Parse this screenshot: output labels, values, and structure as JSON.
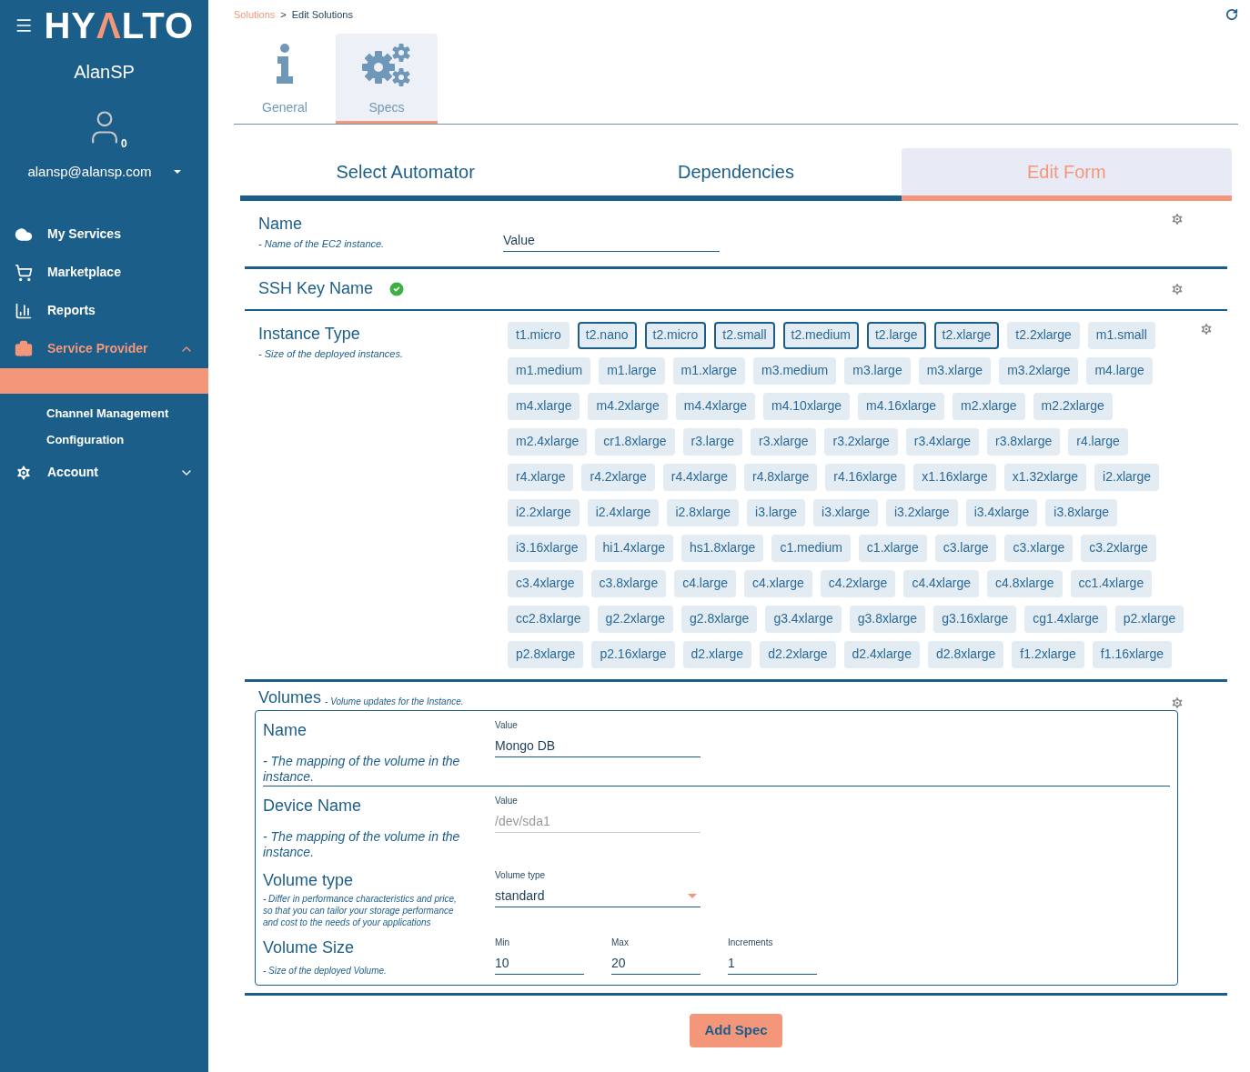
{
  "sidebar": {
    "logo": [
      {
        "text": "HY",
        "accent": false
      },
      {
        "text": "Λ",
        "accent": true
      },
      {
        "text": "LTO",
        "accent": false
      }
    ],
    "user": "AlanSP",
    "notifications": "0",
    "email": "alansp@alansp.com",
    "nav": [
      {
        "kind": "cloud",
        "label": "My Services",
        "selected": false
      },
      {
        "kind": "cart",
        "label": "Marketplace",
        "selected": false
      },
      {
        "kind": "chart",
        "label": "Reports",
        "selected": false
      },
      {
        "kind": "briefcase",
        "label": "Service Provider",
        "selected": true,
        "expanded": true,
        "children": [
          {
            "label": "Channel Management"
          },
          {
            "label": "Configuration"
          }
        ]
      },
      {
        "kind": "gear",
        "label": "Account",
        "selected": false,
        "expanded": false
      }
    ]
  },
  "breadcrumb": [
    {
      "label": "Solutions",
      "link": true
    },
    {
      "label": ">",
      "link": false
    },
    {
      "label": "Edit Solutions",
      "link": false
    }
  ],
  "tabs": [
    {
      "kind": "info",
      "label": "General",
      "selected": false
    },
    {
      "kind": "gears",
      "label": "Specs",
      "selected": true
    }
  ],
  "subtabs": [
    {
      "label": "Select Automator",
      "selected": false
    },
    {
      "label": "Dependencies",
      "selected": false
    },
    {
      "label": "Edit Form",
      "selected": true
    }
  ],
  "name_field": {
    "title": "Name",
    "description": "- Name of the EC2 instance.",
    "value": "Value"
  },
  "ssh_key": {
    "title": "SSH Key Name",
    "valid": true
  },
  "instance_type": {
    "title": "Instance Type",
    "description": "- Size of the deployed instances.",
    "types": [
      {
        "label": "t1.micro",
        "selected": false
      },
      {
        "label": "t2.nano",
        "selected": true
      },
      {
        "label": "t2.micro",
        "selected": true
      },
      {
        "label": "t2.small",
        "selected": true
      },
      {
        "label": "t2.medium",
        "selected": true
      },
      {
        "label": "t2.large",
        "selected": true
      },
      {
        "label": "t2.xlarge",
        "selected": true
      },
      {
        "label": "t2.2xlarge",
        "selected": false
      },
      {
        "label": "m1.small",
        "selected": false
      },
      {
        "label": "m1.medium",
        "selected": false
      },
      {
        "label": "m1.large",
        "selected": false
      },
      {
        "label": "m1.xlarge",
        "selected": false
      },
      {
        "label": "m3.medium",
        "selected": false
      },
      {
        "label": "m3.large",
        "selected": false
      },
      {
        "label": "m3.xlarge",
        "selected": false
      },
      {
        "label": "m3.2xlarge",
        "selected": false
      },
      {
        "label": "m4.large",
        "selected": false
      },
      {
        "label": "m4.xlarge",
        "selected": false
      },
      {
        "label": "m4.2xlarge",
        "selected": false
      },
      {
        "label": "m4.4xlarge",
        "selected": false
      },
      {
        "label": "m4.10xlarge",
        "selected": false
      },
      {
        "label": "m4.16xlarge",
        "selected": false
      },
      {
        "label": "m2.xlarge",
        "selected": false
      },
      {
        "label": "m2.2xlarge",
        "selected": false
      },
      {
        "label": "m2.4xlarge",
        "selected": false
      },
      {
        "label": "cr1.8xlarge",
        "selected": false
      },
      {
        "label": "r3.large",
        "selected": false
      },
      {
        "label": "r3.xlarge",
        "selected": false
      },
      {
        "label": "r3.2xlarge",
        "selected": false
      },
      {
        "label": "r3.4xlarge",
        "selected": false
      },
      {
        "label": "r3.8xlarge",
        "selected": false
      },
      {
        "label": "r4.large",
        "selected": false
      },
      {
        "label": "r4.xlarge",
        "selected": false
      },
      {
        "label": "r4.2xlarge",
        "selected": false
      },
      {
        "label": "r4.4xlarge",
        "selected": false
      },
      {
        "label": "r4.8xlarge",
        "selected": false
      },
      {
        "label": "r4.16xlarge",
        "selected": false
      },
      {
        "label": "x1.16xlarge",
        "selected": false
      },
      {
        "label": "x1.32xlarge",
        "selected": false
      },
      {
        "label": "i2.xlarge",
        "selected": false
      },
      {
        "label": "i2.2xlarge",
        "selected": false
      },
      {
        "label": "i2.4xlarge",
        "selected": false
      },
      {
        "label": "i2.8xlarge",
        "selected": false
      },
      {
        "label": "i3.large",
        "selected": false
      },
      {
        "label": "i3.xlarge",
        "selected": false
      },
      {
        "label": "i3.2xlarge",
        "selected": false
      },
      {
        "label": "i3.4xlarge",
        "selected": false
      },
      {
        "label": "i3.8xlarge",
        "selected": false
      },
      {
        "label": "i3.16xlarge",
        "selected": false
      },
      {
        "label": "hi1.4xlarge",
        "selected": false
      },
      {
        "label": "hs1.8xlarge",
        "selected": false
      },
      {
        "label": "c1.medium",
        "selected": false
      },
      {
        "label": "c1.xlarge",
        "selected": false
      },
      {
        "label": "c3.large",
        "selected": false
      },
      {
        "label": "c3.xlarge",
        "selected": false
      },
      {
        "label": "c3.2xlarge",
        "selected": false
      },
      {
        "label": "c3.4xlarge",
        "selected": false
      },
      {
        "label": "c3.8xlarge",
        "selected": false
      },
      {
        "label": "c4.large",
        "selected": false
      },
      {
        "label": "c4.xlarge",
        "selected": false
      },
      {
        "label": "c4.2xlarge",
        "selected": false
      },
      {
        "label": "c4.4xlarge",
        "selected": false
      },
      {
        "label": "c4.8xlarge",
        "selected": false
      },
      {
        "label": "cc1.4xlarge",
        "selected": false
      },
      {
        "label": "cc2.8xlarge",
        "selected": false
      },
      {
        "label": "g2.2xlarge",
        "selected": false
      },
      {
        "label": "g2.8xlarge",
        "selected": false
      },
      {
        "label": "g3.4xlarge",
        "selected": false
      },
      {
        "label": "g3.8xlarge",
        "selected": false
      },
      {
        "label": "g3.16xlarge",
        "selected": false
      },
      {
        "label": "cg1.4xlarge",
        "selected": false
      },
      {
        "label": "p2.xlarge",
        "selected": false
      },
      {
        "label": "p2.8xlarge",
        "selected": false
      },
      {
        "label": "p2.16xlarge",
        "selected": false
      },
      {
        "label": "d2.xlarge",
        "selected": false
      },
      {
        "label": "d2.2xlarge",
        "selected": false
      },
      {
        "label": "d2.4xlarge",
        "selected": false
      },
      {
        "label": "d2.8xlarge",
        "selected": false
      },
      {
        "label": "f1.2xlarge",
        "selected": false
      },
      {
        "label": "f1.16xlarge",
        "selected": false
      }
    ]
  },
  "volumes": {
    "title": "Volumes",
    "description": "- Volume updates for the Instance.",
    "name": {
      "title": "Name",
      "description": "- The mapping of the volume in the instance.",
      "field_label": "Value",
      "value": "Mongo DB"
    },
    "device": {
      "title": "Device Name",
      "description": "- The mapping of the volume in the instance.",
      "field_label": "Value",
      "placeholder": "/dev/sda1"
    },
    "type": {
      "title": "Volume type",
      "description": "- Differ in performance characteristics and price, so that you can tailor your storage performance and cost to the needs of your applications",
      "field_label": "Volume type",
      "value": "standard"
    },
    "size": {
      "title": "Volume Size",
      "description": "- Size of the deployed Volume.",
      "fields": [
        {
          "label": "Min",
          "value": "10"
        },
        {
          "label": "Max",
          "value": "20"
        },
        {
          "label": "Increments",
          "value": "1"
        }
      ]
    }
  },
  "add_button": "Add Spec"
}
